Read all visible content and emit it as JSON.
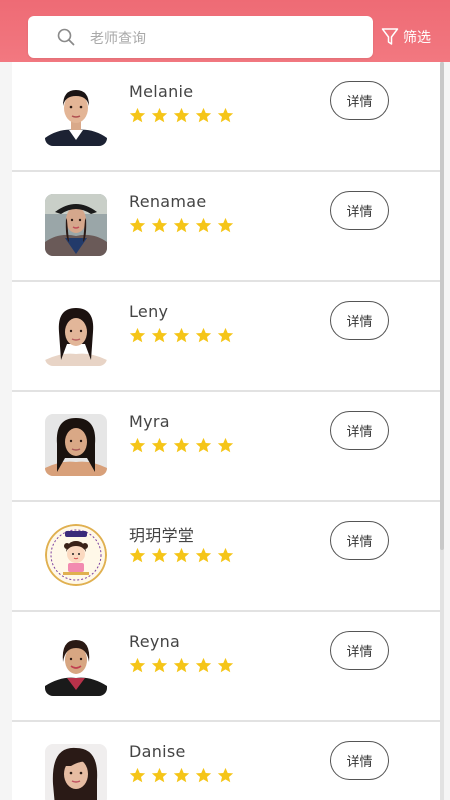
{
  "search": {
    "placeholder": "老师查询",
    "icon": "search-icon"
  },
  "filter": {
    "label": "筛选",
    "icon": "filter-icon"
  },
  "colors": {
    "header": "#f07178",
    "star": "#f5c518",
    "accent": "#ffffff"
  },
  "teachers": [
    {
      "name": "Melanie",
      "rating": 5,
      "button": "详情",
      "avatar": "avatar-photo"
    },
    {
      "name": "Renamae",
      "rating": 5,
      "button": "详情",
      "avatar": "avatar-photo"
    },
    {
      "name": "Leny",
      "rating": 5,
      "button": "详情",
      "avatar": "avatar-photo"
    },
    {
      "name": "Myra",
      "rating": 5,
      "button": "详情",
      "avatar": "avatar-photo"
    },
    {
      "name": "玥玥学堂",
      "rating": 5,
      "button": "详情",
      "avatar": "avatar-logo"
    },
    {
      "name": "Reyna",
      "rating": 5,
      "button": "详情",
      "avatar": "avatar-photo"
    },
    {
      "name": "Danise",
      "rating": 5,
      "button": "详情",
      "avatar": "avatar-photo"
    }
  ]
}
